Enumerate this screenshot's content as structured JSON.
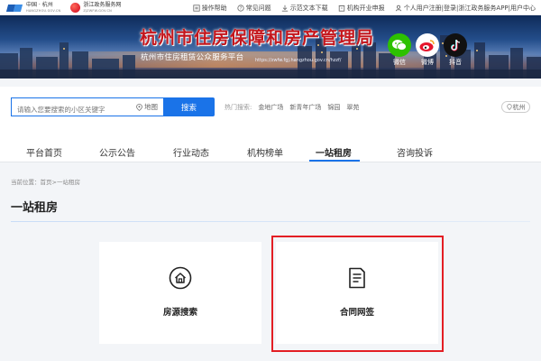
{
  "topbar": {
    "brand_cn": "中国 · 杭州",
    "brand_en": "HANGZHOU.GOV.CN",
    "zj_name": "浙江政务服务网",
    "zj_en": "ZJZWFW.GOV.CN",
    "links": [
      {
        "label": "操作帮助",
        "icon": "help-icon"
      },
      {
        "label": "常见问题",
        "icon": "question-icon"
      },
      {
        "label": "示范文本下载",
        "icon": "download-icon"
      },
      {
        "label": "机构开业申报",
        "icon": "building-icon"
      },
      {
        "label": "个人用户注册|登录|浙江政务服务APP|用户中心",
        "icon": "user-icon"
      }
    ]
  },
  "banner": {
    "title": "杭州市住房保障和房产管理局",
    "subtitle": "杭州市住房租赁公众服务平台",
    "url": "https://zwfw.fgj.hangzhou.gov.cn/hzzf/",
    "social": [
      {
        "label": "微信",
        "icon": "wechat-icon",
        "color": "#2dc100"
      },
      {
        "label": "微博",
        "icon": "weibo-icon",
        "color": "#e6162d"
      },
      {
        "label": "抖音",
        "icon": "douyin-icon",
        "color": "#111111"
      }
    ]
  },
  "search": {
    "placeholder": "请输入您要搜索的小区关键字",
    "map_label": "地图",
    "button_label": "搜索",
    "hot_label": "热门搜索:",
    "hot_keywords": [
      "金地广场",
      "新青年广场",
      "锦园",
      "翠苑"
    ],
    "city": "杭州"
  },
  "nav": {
    "items": [
      "平台首页",
      "公示公告",
      "行业动态",
      "机构榜单",
      "一站租房",
      "咨询投诉"
    ],
    "active_index": 4
  },
  "breadcrumb": "当前位置：首页>一站租房",
  "page_title": "一站租房",
  "cards": [
    {
      "label": "房源搜索",
      "icon": "house-icon"
    },
    {
      "label": "合同网签",
      "icon": "document-icon"
    }
  ],
  "colors": {
    "accent": "#1a73e8",
    "title_red": "#c4161c",
    "highlight": "#e31e24"
  }
}
